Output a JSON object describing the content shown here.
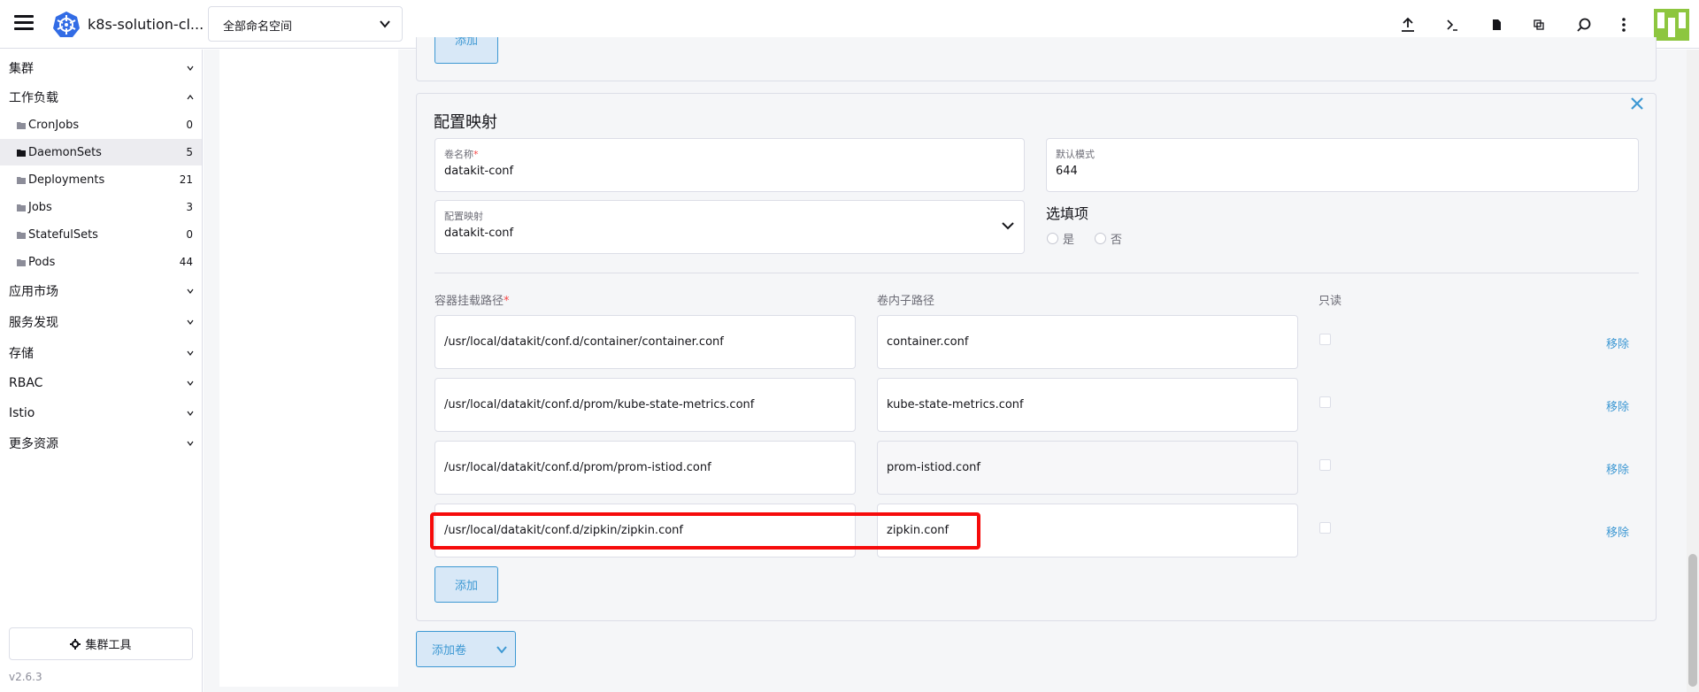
{
  "header": {
    "cluster_name": "k8s-solution-cl...",
    "namespace_value": "全部命名空间"
  },
  "sidebar": {
    "groups": [
      {
        "label": "集群"
      },
      {
        "label": "工作负载"
      },
      {
        "label": "应用市场"
      },
      {
        "label": "服务发现"
      },
      {
        "label": "存储"
      },
      {
        "label": "RBAC"
      },
      {
        "label": "Istio"
      },
      {
        "label": "更多资源"
      }
    ],
    "workload_items": [
      {
        "label": "CronJobs",
        "count": "0"
      },
      {
        "label": "DaemonSets",
        "count": "5"
      },
      {
        "label": "Deployments",
        "count": "21"
      },
      {
        "label": "Jobs",
        "count": "3"
      },
      {
        "label": "StatefulSets",
        "count": "0"
      },
      {
        "label": "Pods",
        "count": "44"
      }
    ],
    "cluster_tools_label": "集群工具",
    "version": "v2.6.3"
  },
  "top_card": {
    "add_label": "添加"
  },
  "configmap": {
    "title": "配置映射",
    "volume_name": {
      "label": "卷名称",
      "required_mark": "*",
      "value": "datakit-conf"
    },
    "default_mode": {
      "label": "默认模式",
      "value": "644"
    },
    "configmap_select": {
      "label": "配置映射",
      "value": "datakit-conf"
    },
    "optional": {
      "title": "选填项",
      "yes": "是",
      "no": "否"
    },
    "columns": {
      "mount_path": "容器挂载路径",
      "required_mark": "*",
      "sub_path": "卷内子路径",
      "read_only": "只读"
    },
    "rows": [
      {
        "mount_path": "/usr/local/datakit/conf.d/container/container.conf",
        "sub_path": "container.conf",
        "remove": "移除"
      },
      {
        "mount_path": "/usr/local/datakit/conf.d/prom/kube-state-metrics.conf",
        "sub_path": "kube-state-metrics.conf",
        "remove": "移除"
      },
      {
        "mount_path": "/usr/local/datakit/conf.d/prom/prom-istiod.conf",
        "sub_path": "prom-istiod.conf",
        "remove": "移除"
      },
      {
        "mount_path": "/usr/local/datakit/conf.d/zipkin/zipkin.conf",
        "sub_path": "zipkin.conf",
        "remove": "移除"
      }
    ],
    "add_label": "添加"
  },
  "add_volume_label": "添加卷",
  "colors": {
    "accent": "#3d98d3",
    "accent_bg": "#d8e8f7",
    "highlight": "#f60b0b",
    "required": "#f64747",
    "brand_logo": "#326ce5",
    "avatar": "#8dc63f"
  }
}
